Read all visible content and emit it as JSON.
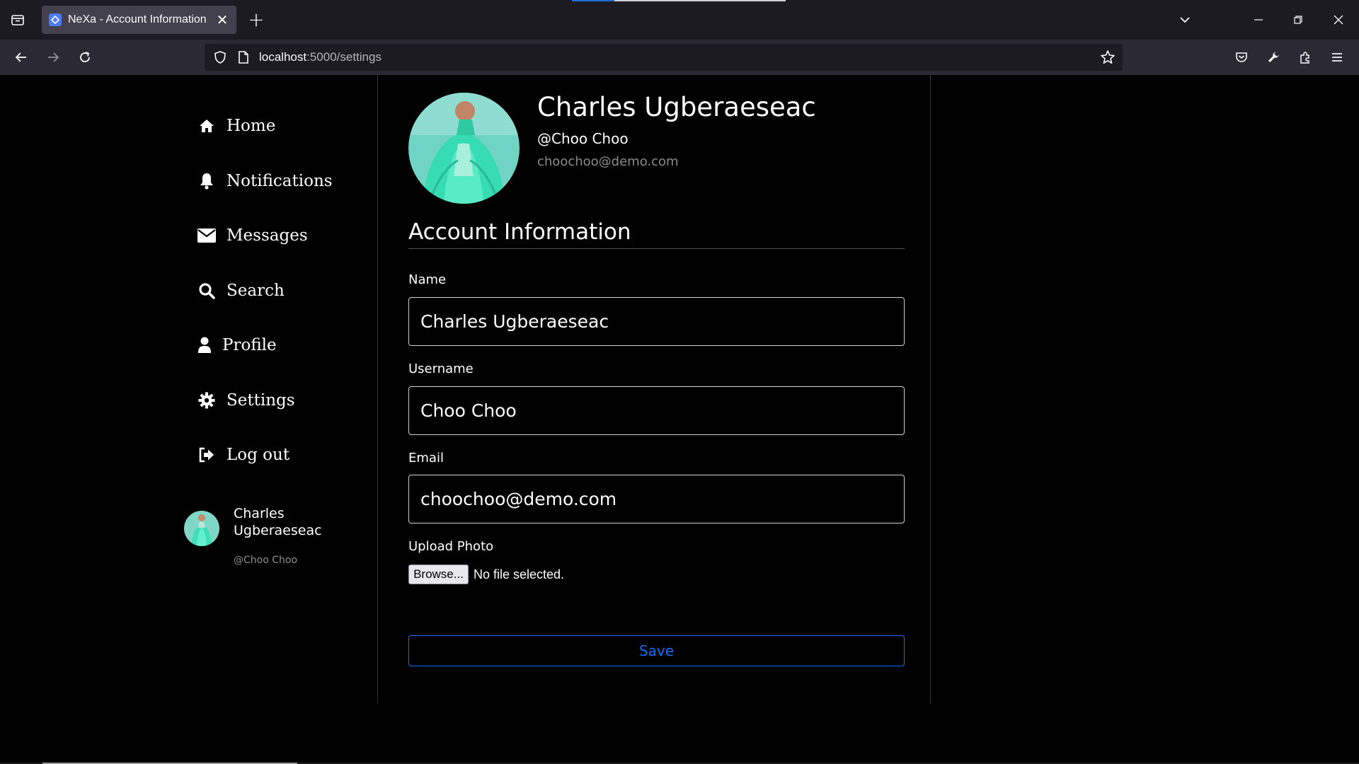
{
  "browser": {
    "tab_title": "NeXa - Account Information",
    "tab_close": "✕",
    "new_tab": "+",
    "url_host": "localhost",
    "url_path": ":5000/settings"
  },
  "sidebar": {
    "items": [
      {
        "label": "Home",
        "icon": "home-icon"
      },
      {
        "label": "Notifications",
        "icon": "bell-icon"
      },
      {
        "label": "Messages",
        "icon": "envelope-icon"
      },
      {
        "label": "Search",
        "icon": "search-icon"
      },
      {
        "label": "Profile",
        "icon": "user-icon"
      },
      {
        "label": "Settings",
        "icon": "gear-icon"
      },
      {
        "label": "Log out",
        "icon": "logout-icon"
      }
    ],
    "user_name": "Charles Ugberaeseac",
    "user_handle": "@Choo Choo"
  },
  "profile": {
    "name": "Charles Ugberaeseac",
    "handle": "@Choo Choo",
    "email": "choochoo@demo.com"
  },
  "form": {
    "section_title": "Account Information",
    "name_label": "Name",
    "name_value": "Charles Ugberaeseac",
    "username_label": "Username",
    "username_value": "Choo Choo",
    "email_label": "Email",
    "email_value": "choochoo@demo.com",
    "upload_label": "Upload Photo",
    "browse_label": "Browse...",
    "file_status": "No file selected.",
    "save_label": "Save"
  },
  "colors": {
    "accent": "#0d6efd",
    "background": "#000000",
    "avatar_teal": "#3fe0b8"
  }
}
